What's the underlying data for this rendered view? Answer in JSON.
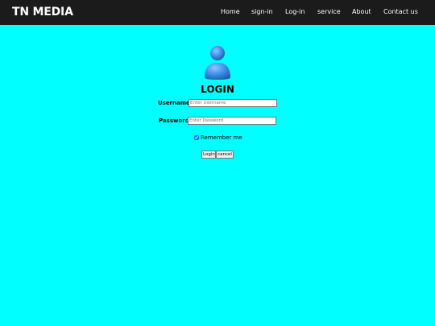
{
  "navbar": {
    "brand": "TN MEDIA",
    "links": [
      {
        "label": "Home"
      },
      {
        "label": "sign-in"
      },
      {
        "label": "Log-in"
      },
      {
        "label": "service"
      },
      {
        "label": "About"
      },
      {
        "label": "Contact us"
      }
    ]
  },
  "login": {
    "avatar_icon": "user-avatar-icon",
    "title": "LOGIN",
    "username": {
      "label": "Username",
      "placeholder": "Enter Username",
      "value": ""
    },
    "password": {
      "label": "Password",
      "placeholder": "Enter Password",
      "value": ""
    },
    "remember": {
      "label": "Remember me",
      "checked": true
    },
    "buttons": {
      "login": "Login",
      "cancel": "cancel"
    }
  },
  "colors": {
    "background": "#00ffff",
    "navbar": "#1c1b1c",
    "avatar": "#3a8ee6"
  }
}
